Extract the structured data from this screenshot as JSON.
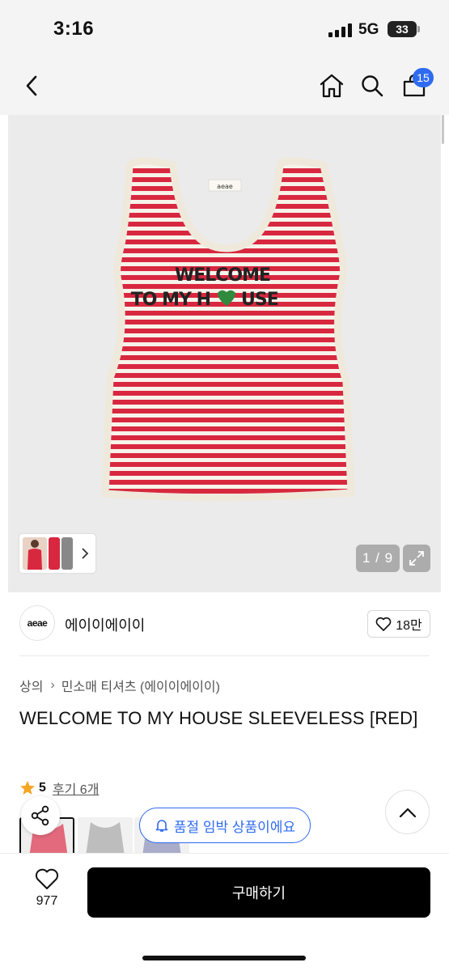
{
  "status_bar": {
    "time": "3:16",
    "network": "5G",
    "battery": "33"
  },
  "header": {
    "cart_count": "15",
    "icons": [
      "back-icon",
      "home-icon",
      "search-icon",
      "cart-icon"
    ]
  },
  "product_image": {
    "print_line1": "WELCOME",
    "print_line2": "TO MY H",
    "print_line2b": "USE",
    "label_text": "aeae",
    "counter": "1 / 9",
    "stripe_color": "#d8283f",
    "base_color": "#f7f3ea"
  },
  "brand": {
    "logo_text": "aeae",
    "name": "에이이에이이",
    "likes": "18만"
  },
  "breadcrumb": {
    "category": "상의",
    "subcategory": "민소매 티셔츠 (에이이에이이)"
  },
  "product": {
    "title": "WELCOME TO MY HOUSE SLEEVELESS [RED]",
    "rating": "5",
    "reviews": "후기 6개",
    "stock_notice": "품절 임박 상품이에요"
  },
  "bottom_bar": {
    "wish_count": "977",
    "buy_label": "구매하기"
  },
  "colors": {
    "accent": "#2f6bf0",
    "primary_button": "#000000"
  }
}
